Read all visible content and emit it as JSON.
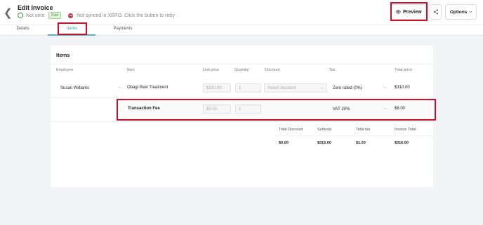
{
  "header": {
    "back_icon": "back-chevron-icon",
    "title": "Edit Invoice",
    "sent_status": "Not sent",
    "paid_badge": "Paid",
    "sync_status": "Not synced in XERO. Click the button to retry",
    "preview_label": "Preview",
    "options_label": "Options",
    "share_icon": "share-icon"
  },
  "tabs": [
    "Details",
    "Items",
    "Payments"
  ],
  "active_tab": "Items",
  "items_section": {
    "title": "Items",
    "columns": [
      "Employee",
      "Item",
      "Unit price",
      "Quantity",
      "Discount",
      "Tax",
      "Total price"
    ],
    "rows": [
      {
        "employee": "Susan Williams",
        "item": "Obagi Peel Treatment",
        "unit_price": "$310.00",
        "quantity": "1",
        "discount_placeholder": "Select discount",
        "tax": "Zero rated (0%)",
        "total": "$310.00"
      },
      {
        "employee": "",
        "item": "Transaction Fee",
        "unit_price": "$5.00",
        "quantity": "1",
        "discount_placeholder": "",
        "tax": "VAT 20%",
        "total": "$6.00"
      }
    ],
    "summary": {
      "labels": [
        "Total Discount",
        "Subtotal",
        "Total tax",
        "Invoice Total"
      ],
      "values": [
        "$0.00",
        "$315.00",
        "$1.00",
        "$316.00"
      ]
    }
  },
  "colors": {
    "accent": "#4fb5c9",
    "highlight_border": "#c8102e",
    "paid_green": "#3a9a3a",
    "sync_red": "#d0344a"
  }
}
